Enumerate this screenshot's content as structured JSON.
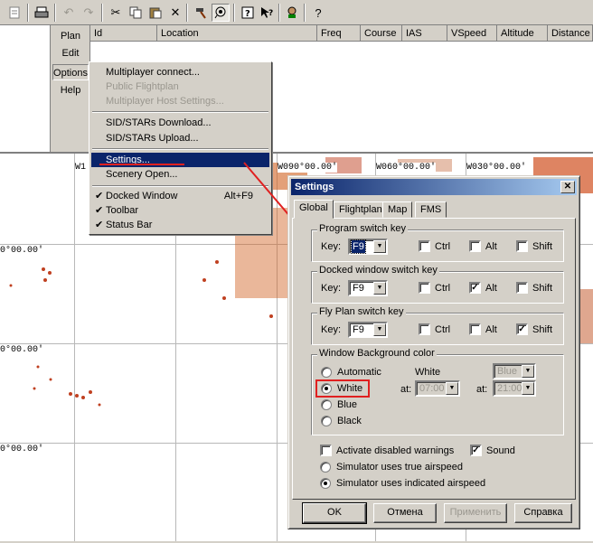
{
  "toolbar": {
    "buttons": [
      {
        "icon": "document-icon"
      },
      {
        "icon": "print-icon"
      },
      {
        "icon": "undo-icon"
      },
      {
        "icon": "redo-icon"
      },
      {
        "icon": "cut-icon"
      },
      {
        "icon": "copy-icon"
      },
      {
        "icon": "paste-icon"
      },
      {
        "icon": "delete-icon"
      },
      {
        "icon": "hammer-icon"
      },
      {
        "icon": "map-pin-icon"
      },
      {
        "icon": "help-topics-icon"
      },
      {
        "icon": "whats-this-icon"
      },
      {
        "icon": "pilot-icon"
      },
      {
        "icon": "question-icon"
      }
    ]
  },
  "menu": {
    "items": [
      "Plan",
      "Edit",
      "Options",
      "Help"
    ]
  },
  "grid": {
    "columns": [
      "Id",
      "Location",
      "Freq",
      "Course",
      "IAS",
      "VSpeed",
      "Altitude",
      "Distance"
    ]
  },
  "options_menu": {
    "items": [
      {
        "label": "Multiplayer connect...",
        "disabled": false
      },
      {
        "label": "Public Flightplan",
        "disabled": true
      },
      {
        "label": "Multiplayer Host Settings...",
        "disabled": true
      },
      {
        "label": "SID/STARs Download...",
        "disabled": false
      },
      {
        "label": "SID/STARs Upload...",
        "disabled": false
      },
      {
        "label": "Settings...",
        "disabled": false,
        "highlighted": true
      },
      {
        "label": "Scenery Open...",
        "disabled": false
      },
      {
        "label": "Docked Window",
        "shortcut": "Alt+F9",
        "checked": true
      },
      {
        "label": "Toolbar",
        "checked": true
      },
      {
        "label": "Status Bar",
        "checked": true
      }
    ]
  },
  "map": {
    "top_labels": [
      "W1",
      "W090°00.00'",
      "W060°00.00'",
      "W030°00.00'"
    ],
    "left_labels": [
      "0°00.00'",
      "0°00.00'",
      "0°00.00'"
    ]
  },
  "dialog": {
    "title": "Settings",
    "tabs": [
      "Global",
      "Flightplan",
      "Map",
      "FMS"
    ],
    "program_switch": {
      "title": "Program switch key",
      "key_label": "Key:",
      "key": "F9",
      "ctrl": false,
      "alt": false,
      "shift": false
    },
    "docked_switch": {
      "title": "Docked window switch key",
      "key_label": "Key:",
      "key": "F9",
      "ctrl": false,
      "alt": true,
      "shift": false
    },
    "flyplan_switch": {
      "title": "Fly Plan switch key",
      "key_label": "Key:",
      "key": "F9",
      "ctrl": false,
      "alt": false,
      "shift": true
    },
    "modifiers": {
      "ctrl": "Ctrl",
      "alt": "Alt",
      "shift": "Shift"
    },
    "background": {
      "title": "Window Background color",
      "options": [
        "Automatic",
        "White",
        "Blue",
        "Black"
      ],
      "selected": "White",
      "col1_label": "White",
      "col2_value": "Blue",
      "at_label": "at:",
      "time1": "07:00",
      "time2": "21:00"
    },
    "checks": {
      "activate_disabled_warnings": {
        "label": "Activate disabled warnings",
        "checked": false
      },
      "sound": {
        "label": "Sound",
        "checked": true
      }
    },
    "airspeed": {
      "true_label": "Simulator uses true airspeed",
      "indicated_label": "Simulator uses indicated airspeed",
      "selected": "indicated"
    },
    "buttons": {
      "ok": "OK",
      "cancel": "Отмена",
      "apply": "Применить",
      "help": "Справка"
    }
  },
  "colors": {
    "highlight": "#0a246a",
    "annotation_red": "#e02020",
    "dialog_bg": "#d4d0c8"
  }
}
